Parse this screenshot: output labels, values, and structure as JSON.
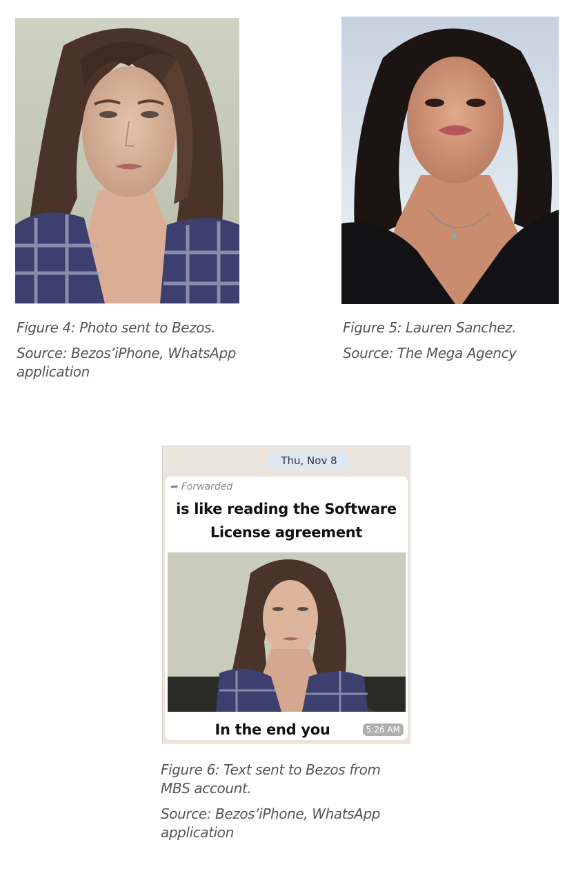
{
  "figures": [
    {
      "caption": "Figure 4: Photo sent to Bezos.",
      "source": "Source: Bezos’iPhone, WhatsApp application"
    },
    {
      "caption": "Figure 5: Lauren Sanchez.",
      "source": "Source: The Mega Agency"
    },
    {
      "caption": "Figure 6: Text sent to Bezos from MBS account.",
      "source": "Source: Bezos’iPhone, WhatsApp application"
    }
  ],
  "whatsapp": {
    "date": "Thu, Nov 8",
    "forwarded_label": "Forwarded",
    "text_line1": "is like reading the Software",
    "text_line2": "License agreement",
    "text_bottom": "In the end you",
    "time": "5:26 AM"
  }
}
